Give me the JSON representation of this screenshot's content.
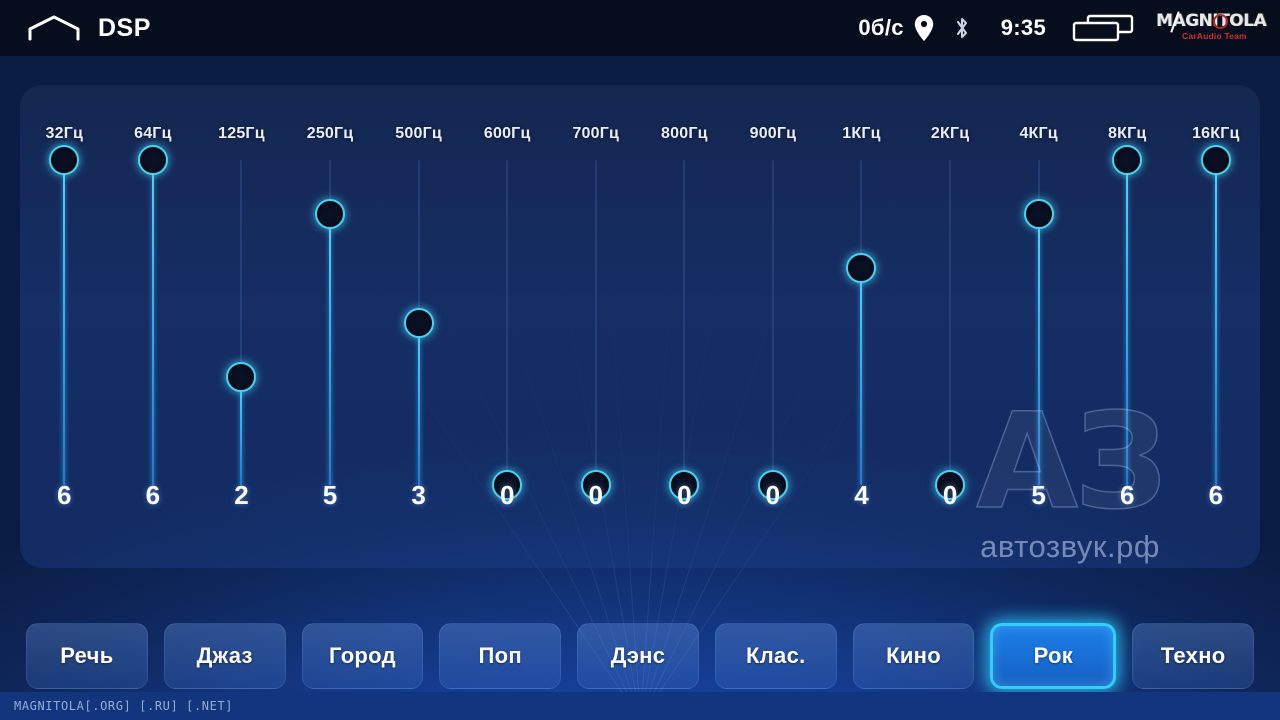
{
  "statusbar": {
    "home_icon": "home-icon",
    "title": "DSP",
    "speed": "0б/c",
    "location_icon": "location-pin-icon",
    "bluetooth_icon": "bluetooth-icon",
    "time": "9:35",
    "battery_icon": "battery-icon",
    "logo_text": "MAGNITOLA",
    "logo_sub": "CarAudio Team"
  },
  "watermark": {
    "big": "АЗ",
    "small": "автозвук.рф"
  },
  "equalizer": {
    "min": 0,
    "max": 6,
    "bands": [
      {
        "freq": "32Гц",
        "value": "6"
      },
      {
        "freq": "64Гц",
        "value": "6"
      },
      {
        "freq": "125Гц",
        "value": "2"
      },
      {
        "freq": "250Гц",
        "value": "5"
      },
      {
        "freq": "500Гц",
        "value": "3"
      },
      {
        "freq": "600Гц",
        "value": "0"
      },
      {
        "freq": "700Гц",
        "value": "0"
      },
      {
        "freq": "800Гц",
        "value": "0"
      },
      {
        "freq": "900Гц",
        "value": "0"
      },
      {
        "freq": "1КГц",
        "value": "4"
      },
      {
        "freq": "2КГц",
        "value": "0"
      },
      {
        "freq": "4КГц",
        "value": "5"
      },
      {
        "freq": "8КГц",
        "value": "6"
      },
      {
        "freq": "16КГц",
        "value": "6"
      }
    ]
  },
  "presets": {
    "active_index": 7,
    "items": [
      {
        "label": "Речь"
      },
      {
        "label": "Джаз"
      },
      {
        "label": "Город"
      },
      {
        "label": "Поп"
      },
      {
        "label": "Дэнс"
      },
      {
        "label": "Клас."
      },
      {
        "label": "Кино"
      },
      {
        "label": "Рок"
      },
      {
        "label": "Техно"
      }
    ]
  },
  "bottombar": {
    "text": "MAGNITOLA[.ORG] [.RU] [.NET]"
  },
  "colors": {
    "accent_cyan": "#2fd0ff",
    "knob_border": "#46d2f2",
    "panel_bg": "#162852",
    "background_blue": "#1944a8",
    "statusbar_bg": "#060d1c",
    "bottombar_bg": "#11367e"
  }
}
